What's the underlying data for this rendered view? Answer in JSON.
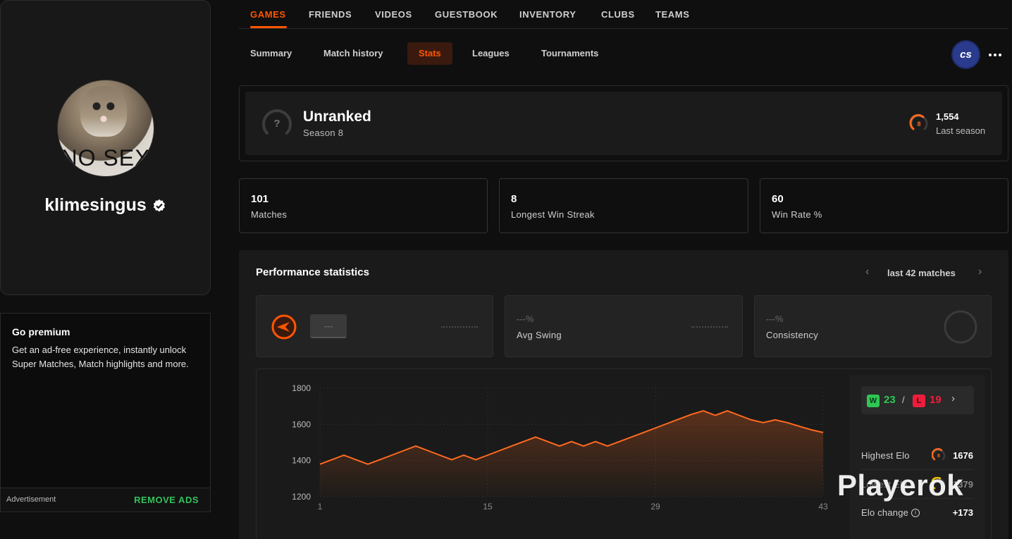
{
  "profile": {
    "username": "klimesingus",
    "avatar_caption": "NO SEX"
  },
  "premium": {
    "title": "Go premium",
    "text": "Get an ad-free experience, instantly unlock Super Matches, Match highlights and more.",
    "ad_label": "Advertisement",
    "remove_ads": "REMOVE ADS"
  },
  "top_nav": {
    "tabs": [
      "GAMES",
      "FRIENDS",
      "VIDEOS",
      "GUESTBOOK",
      "INVENTORY",
      "CLUBS",
      "TEAMS"
    ],
    "active": "GAMES"
  },
  "sub_nav": {
    "tabs": [
      "Summary",
      "Match history",
      "Stats",
      "Leagues",
      "Tournaments"
    ],
    "active": "Stats"
  },
  "game_badge": "cs",
  "rank": {
    "title": "Unranked",
    "season": "Season 8",
    "icon_symbol": "?",
    "last_level": "8",
    "last_elo": "1,554",
    "last_label": "Last season"
  },
  "stats": [
    {
      "value": "101",
      "label": "Matches"
    },
    {
      "value": "8",
      "label": "Longest Win Streak"
    },
    {
      "value": "60",
      "label": "Win Rate %"
    }
  ],
  "performance": {
    "title": "Performance statistics",
    "range": "last 42 matches",
    "metrics": [
      {
        "value": "---",
        "label": ""
      },
      {
        "value": "---%",
        "label": "Avg Swing"
      },
      {
        "value": "---%",
        "label": "Consistency"
      }
    ]
  },
  "side": {
    "wins": "23",
    "losses": "19",
    "w_badge": "W",
    "l_badge": "L",
    "sep": "/",
    "highest_label": "Highest Elo",
    "highest_level": "8",
    "highest_value": "1676",
    "lowest_label": "Lowest Elo",
    "lowest_value": "1379",
    "change_label": "Elo change",
    "change_value": "+173"
  },
  "watermark": "Playerok",
  "colors": {
    "accent": "#ff5500",
    "win": "#2ec754",
    "loss": "#ec1e3c",
    "line": "#ff6a1f"
  },
  "chart_data": {
    "type": "area",
    "x_ticks": [
      1,
      15,
      29,
      43
    ],
    "y_ticks": [
      1200,
      1400,
      1600,
      1800
    ],
    "ylim": [
      1200,
      1800
    ],
    "xlim": [
      1,
      43
    ],
    "series": [
      {
        "values": [
          1380,
          1405,
          1430,
          1405,
          1380,
          1405,
          1430,
          1455,
          1480,
          1455,
          1430,
          1405,
          1430,
          1405,
          1430,
          1455,
          1480,
          1505,
          1530,
          1505,
          1480,
          1505,
          1480,
          1505,
          1480,
          1505,
          1530,
          1555,
          1580,
          1605,
          1630,
          1655,
          1675,
          1650,
          1675,
          1650,
          1625,
          1610,
          1625,
          1610,
          1590,
          1570,
          1555
        ]
      }
    ]
  }
}
